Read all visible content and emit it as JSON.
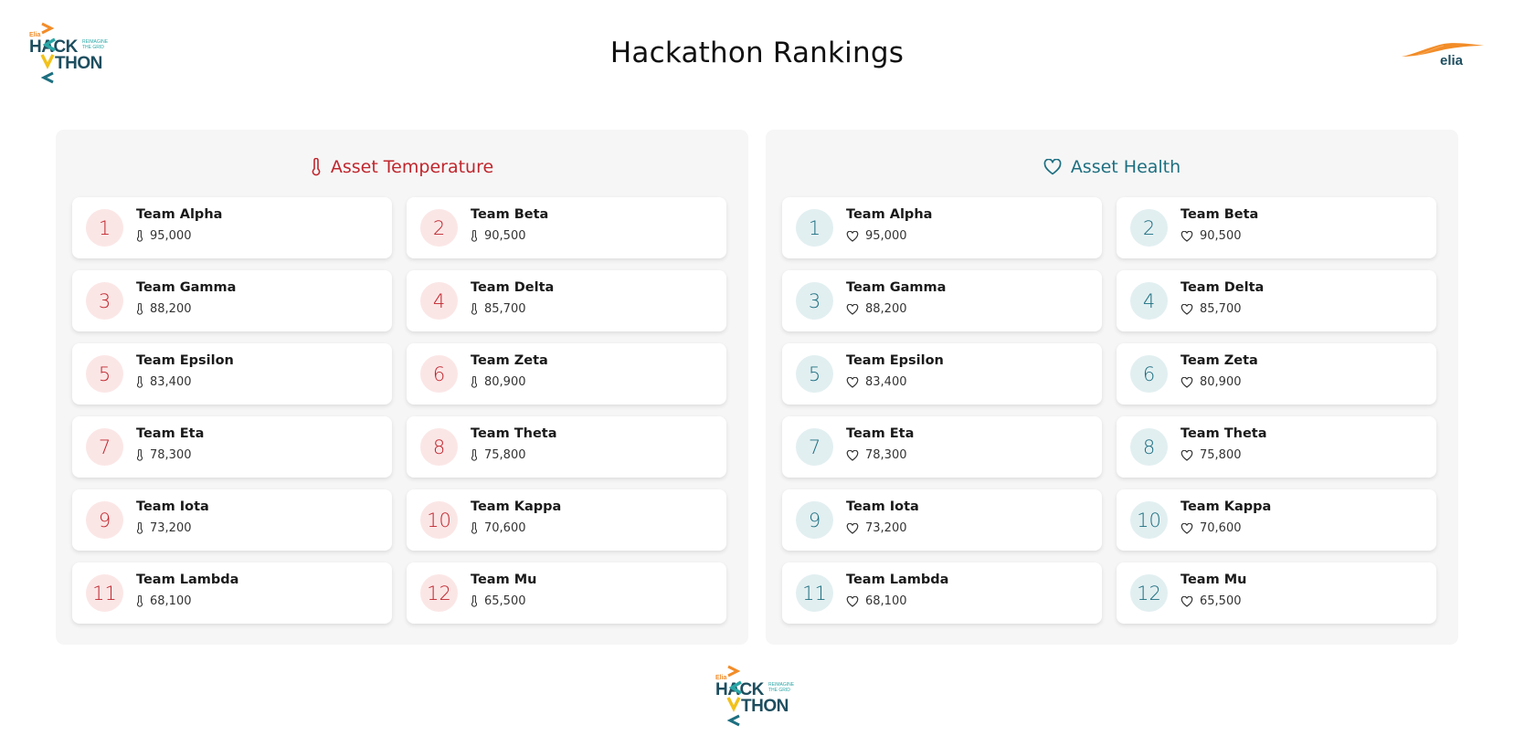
{
  "page": {
    "title": "Hackathon Rankings"
  },
  "logos": {
    "hackathon": {
      "brand": "Elia",
      "line1": "HACK",
      "line2": "THON",
      "tagline1": "REIMAGINE",
      "tagline2": "THE GRID"
    },
    "elia": {
      "text": "elia"
    }
  },
  "colors": {
    "temperature_accent": "#c0262d",
    "temperature_rank_bg": "#fbe6e6",
    "health_accent": "#1d6f80",
    "health_rank_bg": "#e2eff1",
    "logo_orange": "#f28c28",
    "logo_teal": "#2aa6a6",
    "logo_yellow": "#f2c21b",
    "logo_dark": "#1d4e5f"
  },
  "panels": [
    {
      "key": "temperature",
      "title": "Asset Temperature",
      "icon": "thermometer-icon",
      "teams": [
        {
          "rank": "1",
          "name": "Team Alpha",
          "score": "95,000"
        },
        {
          "rank": "2",
          "name": "Team Beta",
          "score": "90,500"
        },
        {
          "rank": "3",
          "name": "Team Gamma",
          "score": "88,200"
        },
        {
          "rank": "4",
          "name": "Team Delta",
          "score": "85,700"
        },
        {
          "rank": "5",
          "name": "Team Epsilon",
          "score": "83,400"
        },
        {
          "rank": "6",
          "name": "Team Zeta",
          "score": "80,900"
        },
        {
          "rank": "7",
          "name": "Team Eta",
          "score": "78,300"
        },
        {
          "rank": "8",
          "name": "Team Theta",
          "score": "75,800"
        },
        {
          "rank": "9",
          "name": "Team Iota",
          "score": "73,200"
        },
        {
          "rank": "10",
          "name": "Team Kappa",
          "score": "70,600"
        },
        {
          "rank": "11",
          "name": "Team Lambda",
          "score": "68,100"
        },
        {
          "rank": "12",
          "name": "Team Mu",
          "score": "65,500"
        }
      ]
    },
    {
      "key": "health",
      "title": "Asset Health",
      "icon": "heart-icon",
      "teams": [
        {
          "rank": "1",
          "name": "Team Alpha",
          "score": "95,000"
        },
        {
          "rank": "2",
          "name": "Team Beta",
          "score": "90,500"
        },
        {
          "rank": "3",
          "name": "Team Gamma",
          "score": "88,200"
        },
        {
          "rank": "4",
          "name": "Team Delta",
          "score": "85,700"
        },
        {
          "rank": "5",
          "name": "Team Epsilon",
          "score": "83,400"
        },
        {
          "rank": "6",
          "name": "Team Zeta",
          "score": "80,900"
        },
        {
          "rank": "7",
          "name": "Team Eta",
          "score": "78,300"
        },
        {
          "rank": "8",
          "name": "Team Theta",
          "score": "75,800"
        },
        {
          "rank": "9",
          "name": "Team Iota",
          "score": "73,200"
        },
        {
          "rank": "10",
          "name": "Team Kappa",
          "score": "70,600"
        },
        {
          "rank": "11",
          "name": "Team Lambda",
          "score": "68,100"
        },
        {
          "rank": "12",
          "name": "Team Mu",
          "score": "65,500"
        }
      ]
    }
  ]
}
